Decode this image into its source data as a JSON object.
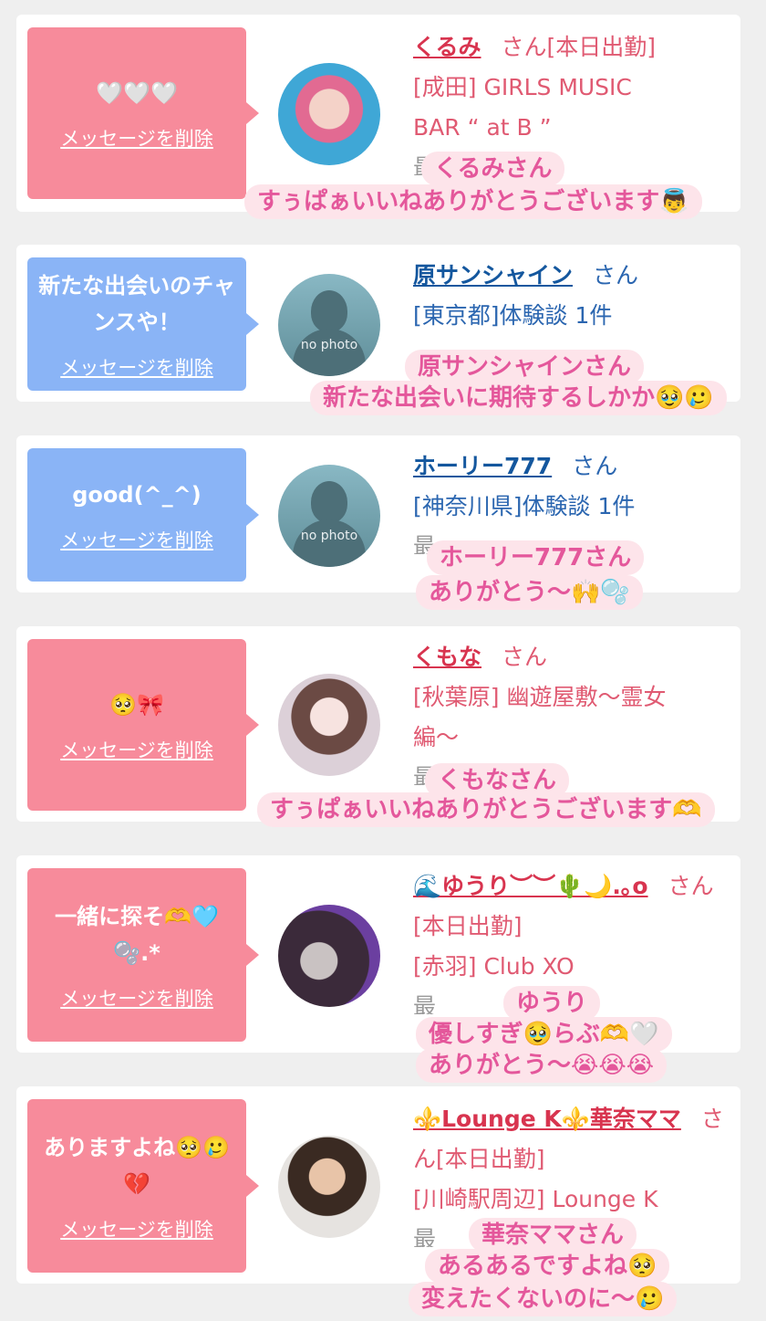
{
  "delete_label": "メッセージを削除",
  "no_photo_label": "no photo",
  "cards": [
    {
      "message": "🤍🤍🤍",
      "name": "くるみ",
      "san": "さん[本日出勤]",
      "shop_line1": "[成田] GIRLS MUSIC",
      "shop_line2": "BAR “ at B ”",
      "faded": "最... 日ス",
      "caption1": "くるみさん",
      "caption2": "すぅぱぁいいねありがとうございます👼"
    },
    {
      "message": "新たな出会いのチャンスや！",
      "name": "原サンシャイン",
      "san": "さん",
      "shop_line1": "[東京都]体験談 1件",
      "caption1": "原サンシャインさん",
      "caption2": "新たな出会いに期待するしかか🥹🥲"
    },
    {
      "message": "good(^_^)",
      "name": "ホーリー777",
      "san": "さん",
      "shop_line1": "[神奈川県]体験談 1件",
      "faded": "最",
      "caption1": "ホーリー777さん",
      "caption2": "ありがとう〜🙌🫧"
    },
    {
      "message": "🥺🎀",
      "name": "くもな",
      "san": "さん",
      "shop_line1": "[秋葉原] 幽遊屋敷〜霊女",
      "shop_line2": "編〜",
      "faded": "最... 日ス",
      "caption1": "くもなさん",
      "caption2": "すぅぱぁいいねありがとうございます🫶"
    },
    {
      "message": "一緒に探そ🫶🩵🫧.*",
      "name": "🌊ゆうり︶︶🌵🌙.｡o",
      "san": "さん[本日出勤]",
      "shop_line1": "[赤羽] Club XO",
      "faded": "最",
      "caption1": "ゆうり",
      "caption2": "優しすぎ🥹らぶ🫶🤍",
      "caption3": "ありがとう〜😭😭😭"
    },
    {
      "message": "ありますよね🥺🥲💔",
      "name": "⚜️Lounge K⚜️華奈ママ",
      "san": "さん[本日出勤]",
      "shop_line1": "[川崎駅周辺] Lounge K",
      "faded": "最",
      "caption1": "華奈ママさん",
      "caption2": "あるあるですよね🥺",
      "caption3": "変えたくないのに〜🥲"
    }
  ],
  "colors": {
    "pink_bubble": "#f78b9b",
    "blue_bubble": "#8ab4f6",
    "caption_text": "#e4579b",
    "caption_bg": "#fde4ea"
  }
}
